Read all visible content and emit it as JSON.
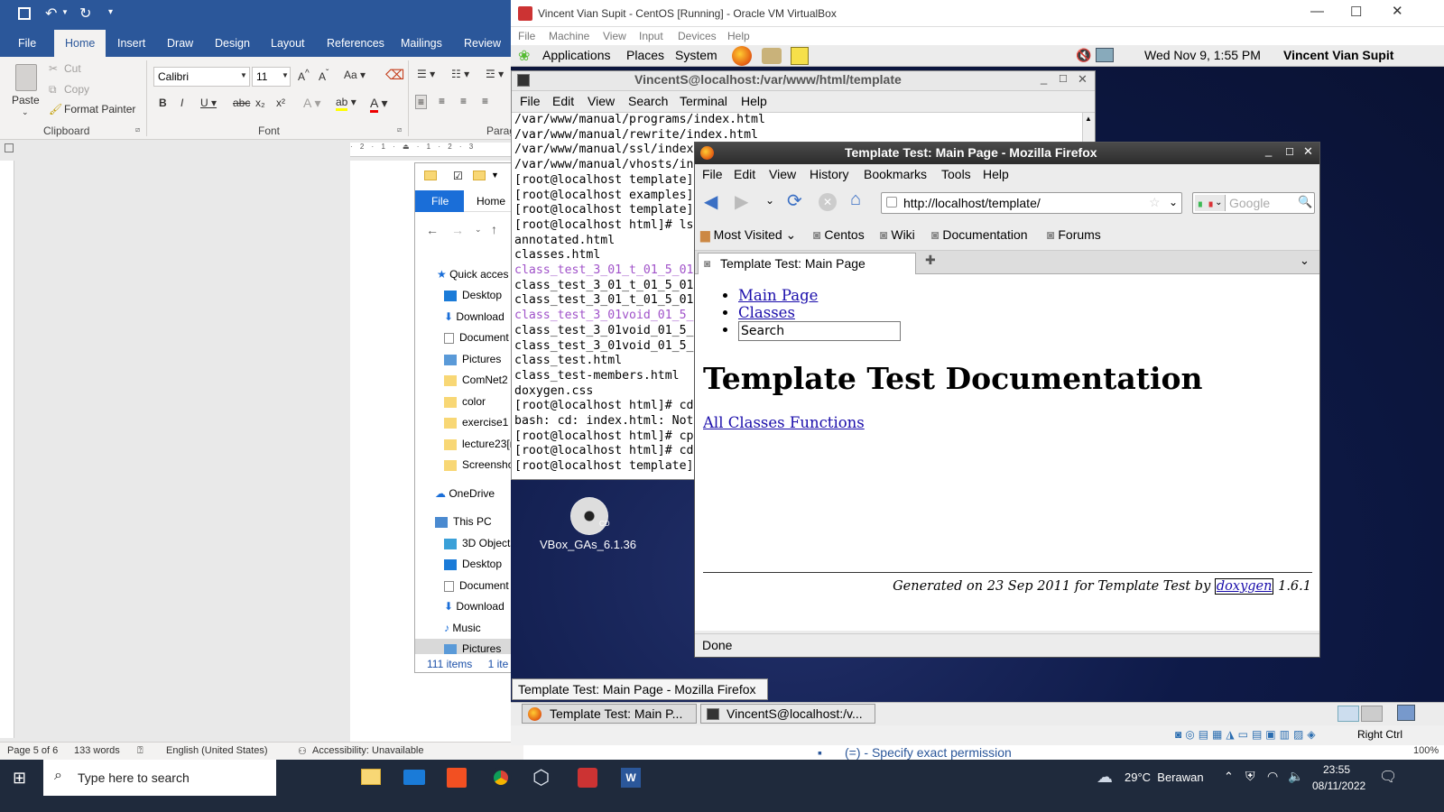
{
  "word": {
    "tabs": [
      "File",
      "Home",
      "Insert",
      "Draw",
      "Design",
      "Layout",
      "References",
      "Mailings",
      "Review"
    ],
    "clipboard": {
      "paste": "Paste",
      "cut": "Cut",
      "copy": "Copy",
      "format_painter": "Format Painter",
      "group": "Clipboard"
    },
    "font": {
      "name": "Calibri",
      "size": "11",
      "group": "Font",
      "para_group": "Parag"
    },
    "status": {
      "page": "Page 5 of 6",
      "words": "133 words",
      "language": "English (United States)",
      "accessibility": "Accessibility: Unavailable"
    },
    "zoom": "100%"
  },
  "explorer": {
    "tabs": [
      "File",
      "Home"
    ],
    "nav": [
      "Quick acces",
      "Desktop",
      "Download",
      "Document",
      "Pictures",
      "ComNet2",
      "color",
      "exercise1",
      "lecture23[r",
      "Screenshot",
      "OneDrive",
      "This PC",
      "3D Objects",
      "Desktop",
      "Document",
      "Download",
      "Music",
      "Pictures"
    ],
    "status": {
      "count": "111 items",
      "selected": "1 ite"
    }
  },
  "vbox": {
    "title": "Vincent Vian Supit - CentOS [Running] - Oracle VM VirtualBox",
    "menu": [
      "File",
      "Machine",
      "View",
      "Input",
      "Devices",
      "Help"
    ],
    "host_key": "Right Ctrl"
  },
  "gnome": {
    "menus": [
      "Applications",
      "Places",
      "System"
    ],
    "datetime": "Wed Nov  9,  1:55 PM",
    "user": "Vincent Vian Supit",
    "desktop_icon": "VBox_GAs_6.1.36",
    "tooltip": "Template Test: Main Page - Mozilla Firefox",
    "tasks": [
      "Template Test: Main P...",
      "VincentS@localhost:/v..."
    ]
  },
  "terminal": {
    "title": "VincentS@localhost:/var/www/html/template",
    "menu": [
      "File",
      "Edit",
      "View",
      "Search",
      "Terminal",
      "Help"
    ],
    "lines": [
      "/var/www/manual/programs/index.html",
      "/var/www/manual/rewrite/index.html",
      "/var/www/manual/ssl/index",
      "/var/www/manual/vhosts/in",
      "[root@localhost template]",
      "[root@localhost examples]",
      "[root@localhost template]",
      "[root@localhost html]# ls",
      "annotated.html",
      "classes.html",
      "class_test_3_01_t_01_5_01",
      "class_test_3_01_t_01_5_01",
      "class_test_3_01_t_01_5_01",
      "class_test_3_01void_01_5_",
      "class_test_3_01void_01_5_",
      "class_test_3_01void_01_5_",
      "class_test.html",
      "class_test-members.html",
      "doxygen.css",
      "[root@localhost html]# cd",
      "bash: cd: index.html: Not",
      "[root@localhost html]# cp",
      "[root@localhost html]# cd",
      "[root@localhost template]"
    ],
    "purple_lines": [
      10,
      13
    ]
  },
  "firefox": {
    "title": "Template Test: Main Page - Mozilla Firefox",
    "menu": [
      "File",
      "Edit",
      "View",
      "History",
      "Bookmarks",
      "Tools",
      "Help"
    ],
    "url": "http://localhost/template/",
    "search_placeholder": "Google",
    "bookmarks": [
      "Most Visited",
      "Centos",
      "Wiki",
      "Documentation",
      "Forums"
    ],
    "tab": "Template Test: Main Page",
    "page": {
      "nav": [
        "Main Page",
        "Classes"
      ],
      "search": "Search",
      "heading": "Template Test Documentation",
      "link": "All Classes Functions",
      "footer_prefix": "Generated on 23 Sep 2011 for Template Test by",
      "footer_link": "doxygen",
      "footer_version": "1.6.1"
    },
    "status": "Done"
  },
  "behind_doc": "(=) - Specify exact permission",
  "taskbar": {
    "search": "Type here to search",
    "weather": "29°C  Berawan",
    "time": "23:55",
    "date": "08/11/2022"
  }
}
